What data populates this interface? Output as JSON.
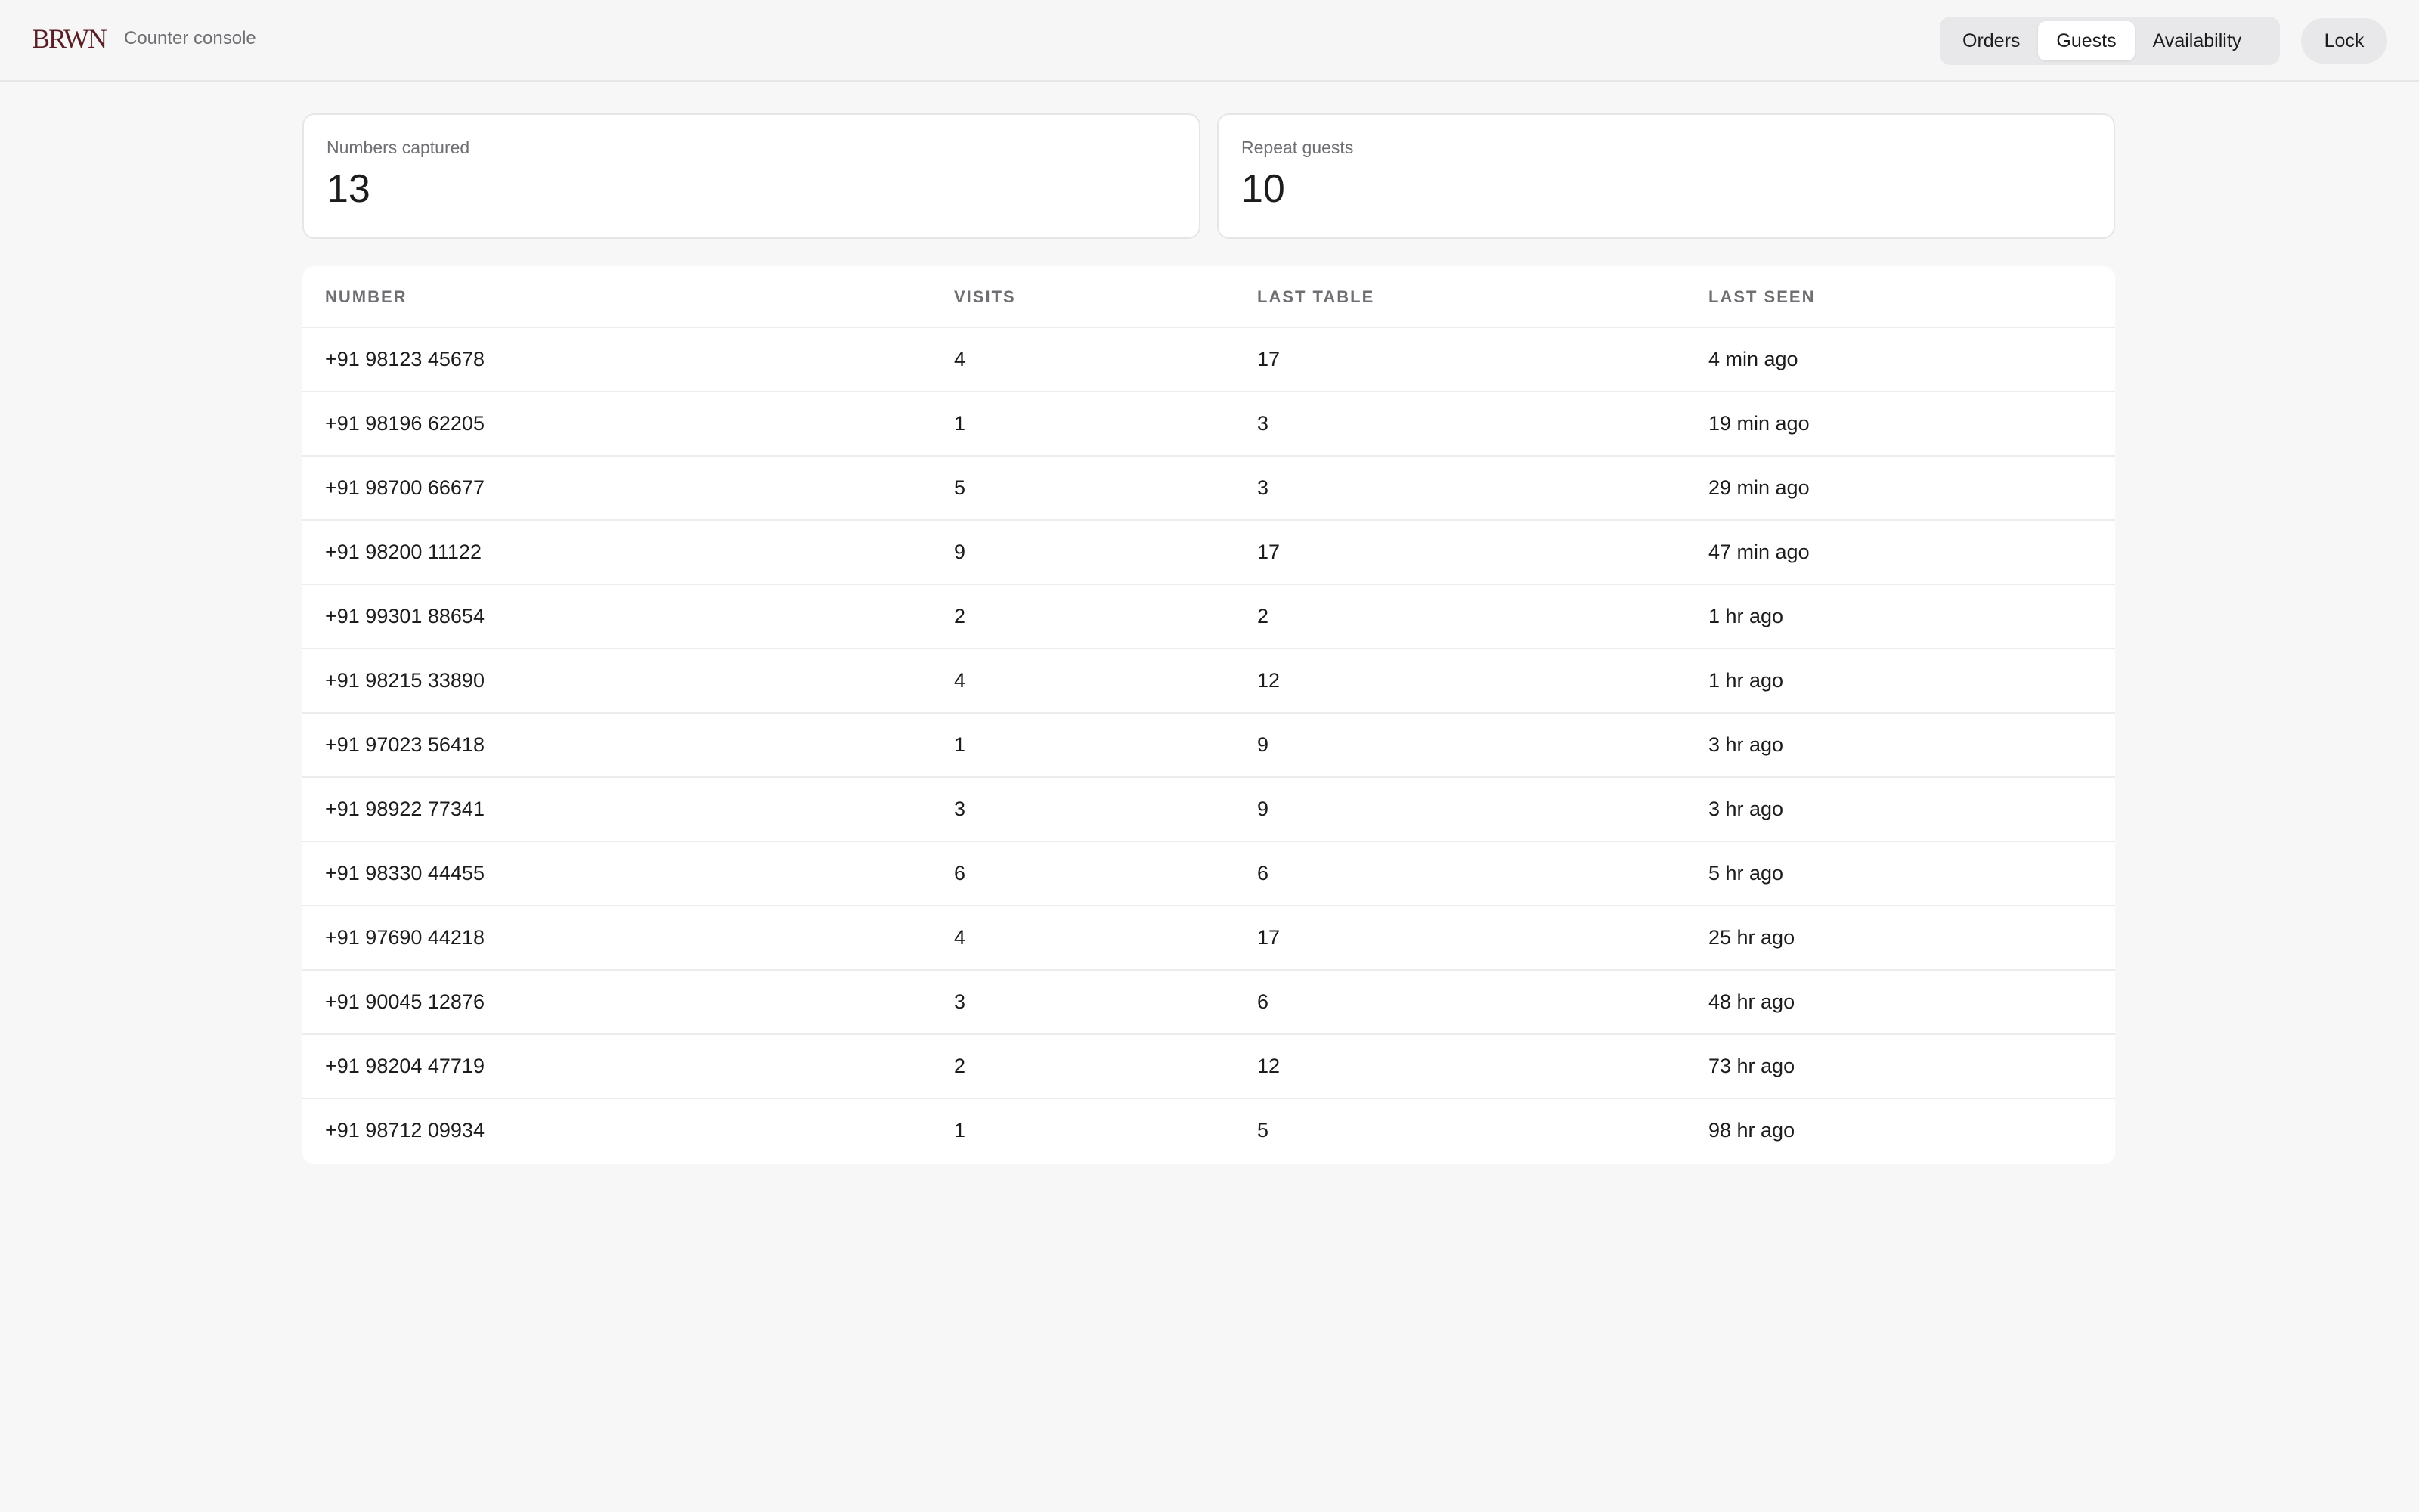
{
  "header": {
    "logo": "BRWN",
    "subtitle": "Counter console",
    "tabs": [
      {
        "label": "Orders",
        "active": false
      },
      {
        "label": "Guests",
        "active": true
      },
      {
        "label": "Availability",
        "active": false
      }
    ],
    "lock_label": "Lock"
  },
  "stats": {
    "numbers_captured": {
      "label": "Numbers captured",
      "value": "13"
    },
    "repeat_guests": {
      "label": "Repeat guests",
      "value": "10"
    }
  },
  "table": {
    "columns": [
      "NUMBER",
      "VISITS",
      "LAST TABLE",
      "LAST SEEN"
    ],
    "rows": [
      [
        "+91 98123 45678",
        "4",
        "17",
        "4 min ago"
      ],
      [
        "+91 98196 62205",
        "1",
        "3",
        "19 min ago"
      ],
      [
        "+91 98700 66677",
        "5",
        "3",
        "29 min ago"
      ],
      [
        "+91 98200 11122",
        "9",
        "17",
        "47 min ago"
      ],
      [
        "+91 99301 88654",
        "2",
        "2",
        "1 hr ago"
      ],
      [
        "+91 98215 33890",
        "4",
        "12",
        "1 hr ago"
      ],
      [
        "+91 97023 56418",
        "1",
        "9",
        "3 hr ago"
      ],
      [
        "+91 98922 77341",
        "3",
        "9",
        "3 hr ago"
      ],
      [
        "+91 98330 44455",
        "6",
        "6",
        "5 hr ago"
      ],
      [
        "+91 97690 44218",
        "4",
        "17",
        "25 hr ago"
      ],
      [
        "+91 90045 12876",
        "3",
        "6",
        "48 hr ago"
      ],
      [
        "+91 98204 47719",
        "2",
        "12",
        "73 hr ago"
      ],
      [
        "+91 98712 09934",
        "1",
        "5",
        "98 hr ago"
      ]
    ]
  },
  "colors": {
    "background": "#f7f7f8",
    "logo": "#5a1f24",
    "text": "#1c1c1e",
    "muted": "#6e6e73"
  }
}
